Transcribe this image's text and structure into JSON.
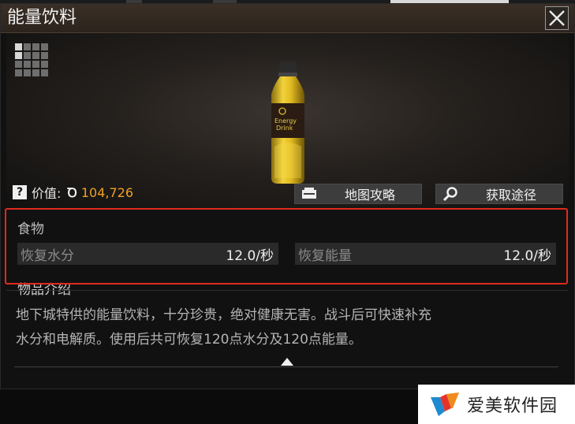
{
  "window": {
    "title": "能量饮料"
  },
  "item": {
    "image_label_line1": "Energy",
    "image_label_line2": "Drink",
    "price_label": "价值:",
    "price_value": "104,726"
  },
  "actions": [
    {
      "label": "地图攻略",
      "icon": "map-icon"
    },
    {
      "label": "获取途径",
      "icon": "search-icon"
    }
  ],
  "category": "食物",
  "stats": [
    {
      "name": "恢复水分",
      "value": "12.0/秒"
    },
    {
      "name": "恢复能量",
      "value": "12.0/秒"
    }
  ],
  "description": {
    "title": "物品介绍",
    "line1": "地下城特供的能量饮料，十分珍贵，绝对健康无害。战斗后可快速补充",
    "line2": "水分和电解质。使用后共可恢复120点水分及120点能量。"
  },
  "watermark": {
    "text": "爱美软件园"
  },
  "colors": {
    "price": "#f0a020",
    "highlight": "#e02a1e",
    "accent_bottle": "#e6c020"
  }
}
